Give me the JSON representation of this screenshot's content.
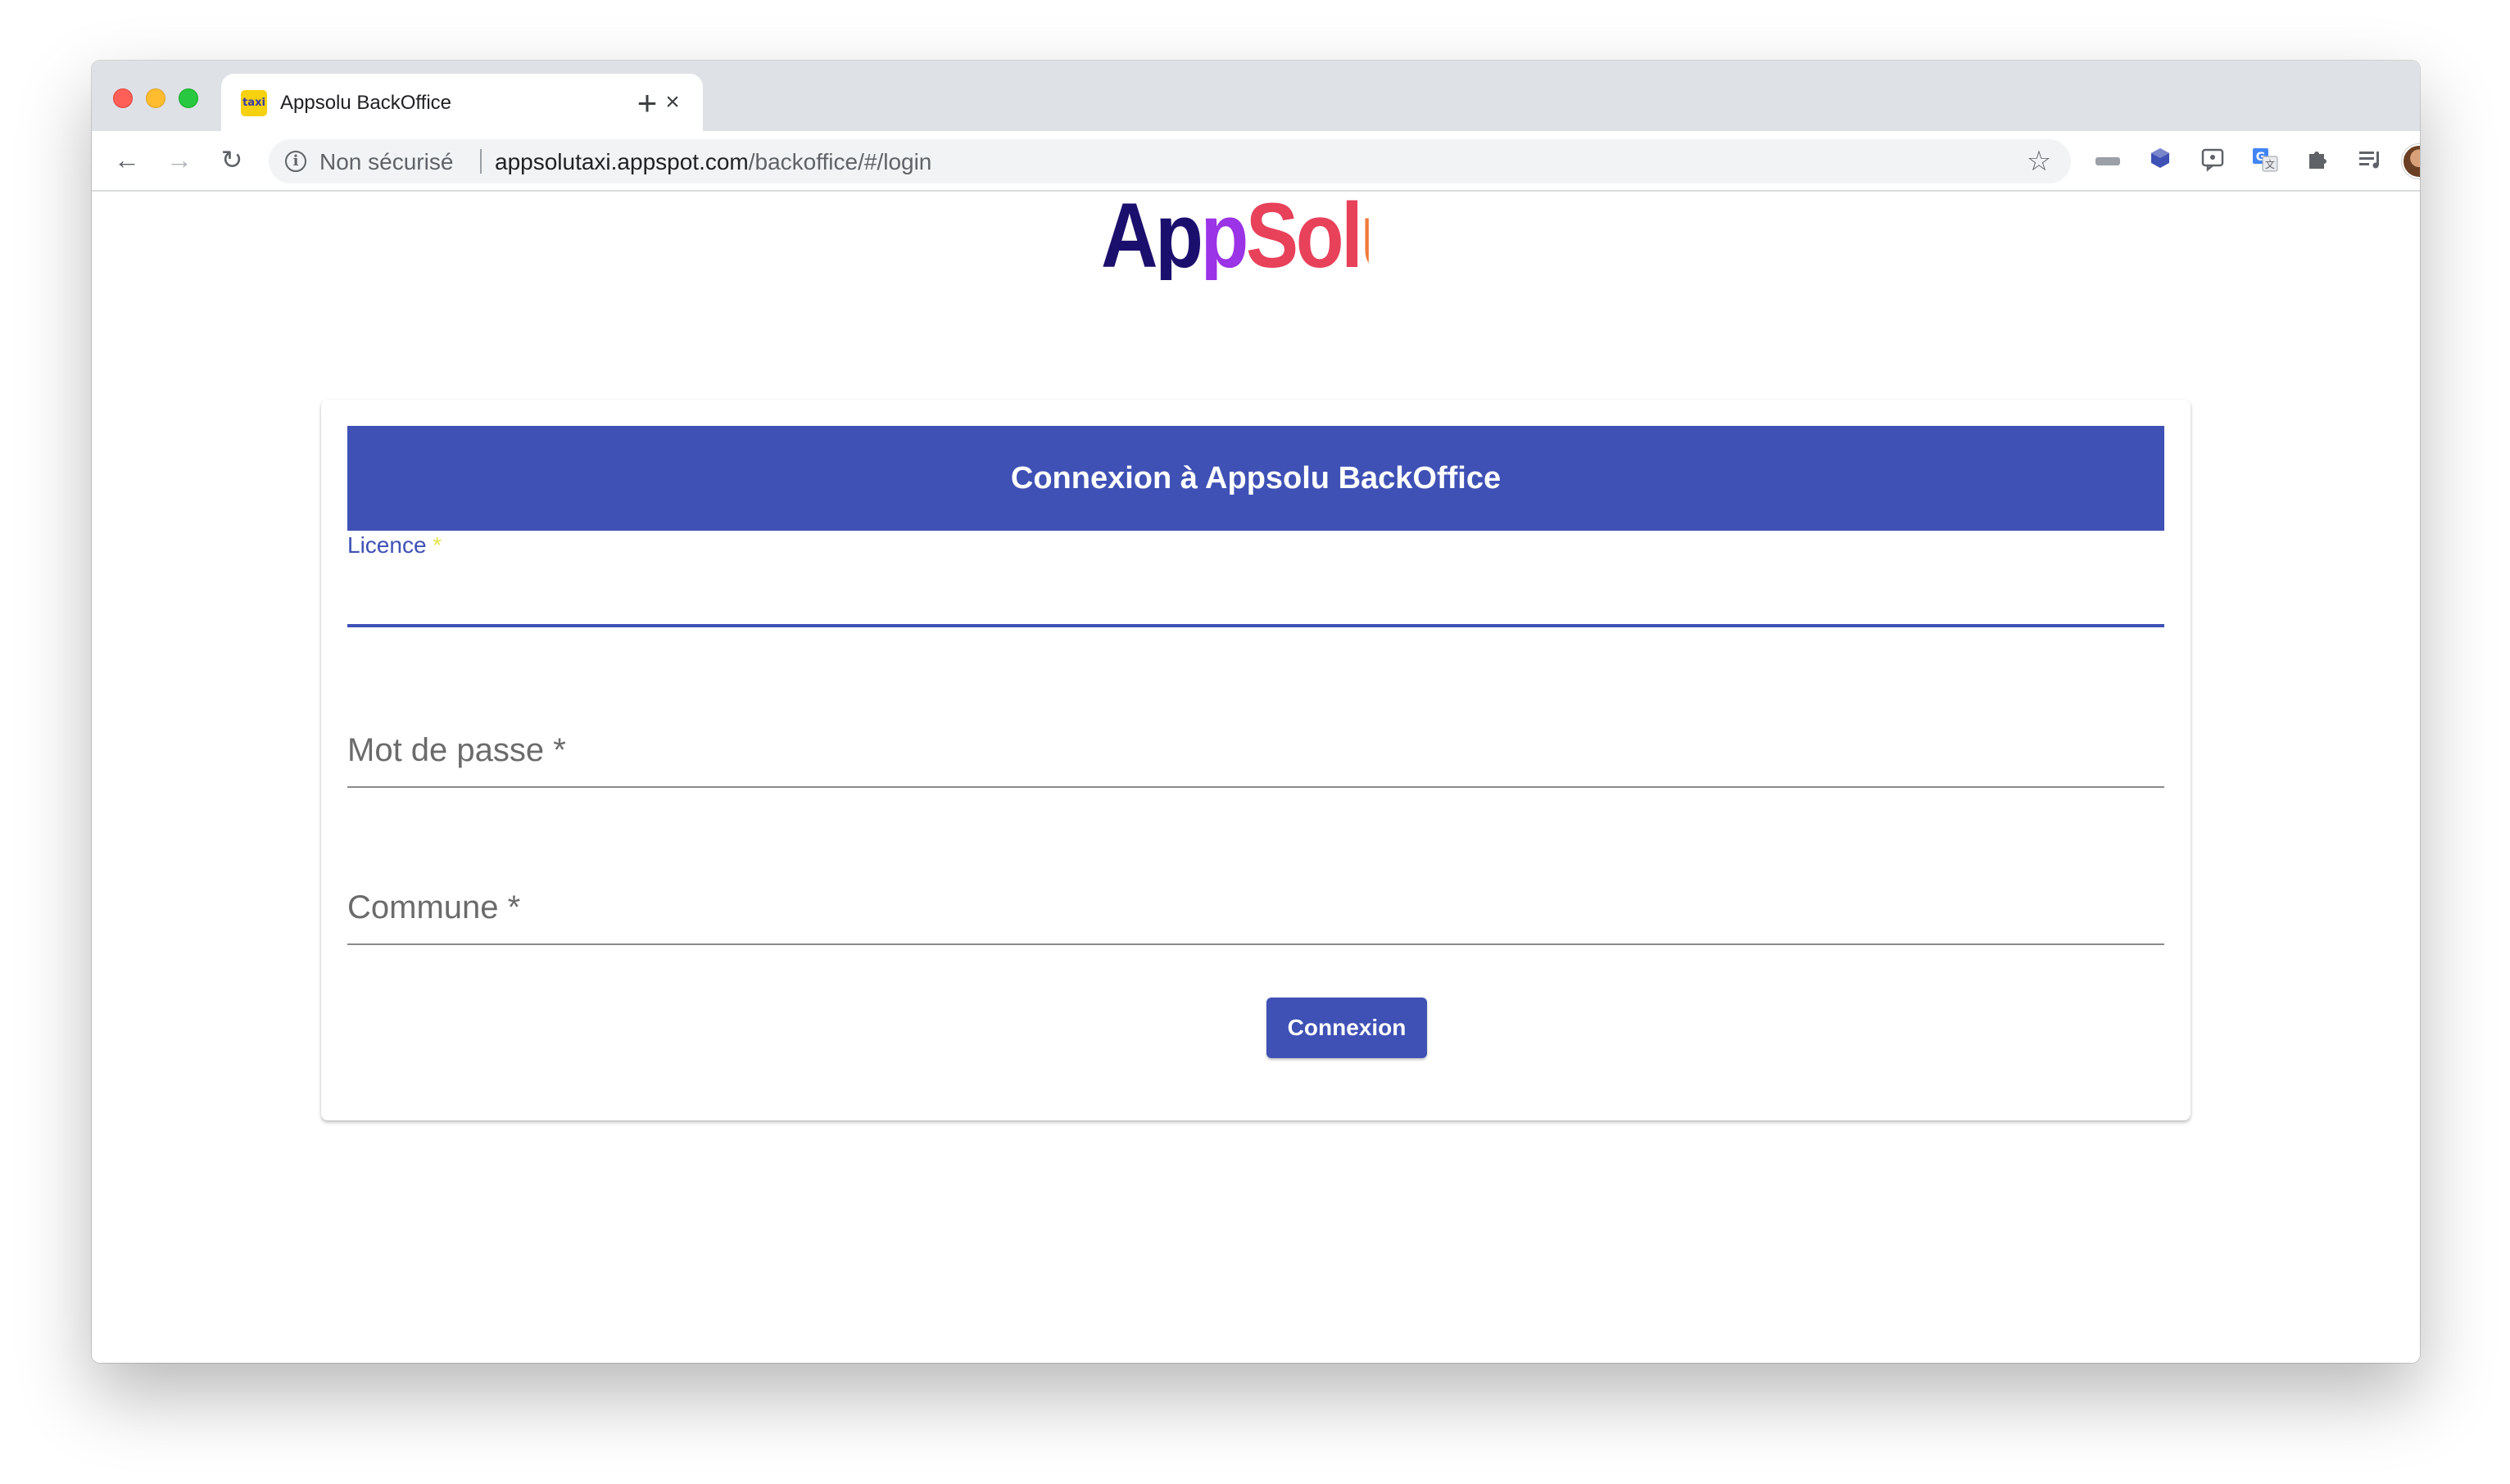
{
  "browser": {
    "tab": {
      "favicon_text": "taxi",
      "title": "Appsolu BackOffice",
      "close_glyph": "×"
    },
    "new_tab_glyph": "+",
    "nav": {
      "back_glyph": "←",
      "forward_glyph": "→",
      "reload_glyph": "↻"
    },
    "omnibox": {
      "info_glyph": "i",
      "security_label": "Non sécurisé",
      "url_host": "appsolutaxi.appspot.com",
      "url_path": "/backoffice/#/login",
      "star_glyph": "☆"
    },
    "extensions": [
      "bookmark-bar-icon",
      "cube-icon",
      "feedback-icon",
      "translate-icon",
      "puzzle-icon",
      "media-queue-icon"
    ],
    "update_glyph": "↑"
  },
  "page": {
    "logo": {
      "part1": "Ap",
      "part2": "p",
      "part3": "Sol",
      "part4": "u"
    },
    "card_title": "Connexion à Appsolu BackOffice",
    "fields": {
      "licence": {
        "label": "Licence",
        "required_mark": " *",
        "value": ""
      },
      "password": {
        "label": "Mot de passe *",
        "value": ""
      },
      "commune": {
        "label": "Commune *",
        "value": ""
      }
    },
    "submit_label": "Connexion"
  },
  "colors": {
    "primary": "#3f51b5",
    "logo_dark": "#1b0f6e",
    "logo_purple": "#9b33e6",
    "logo_red": "#e8415a",
    "logo_orange": "#f07a3a"
  }
}
